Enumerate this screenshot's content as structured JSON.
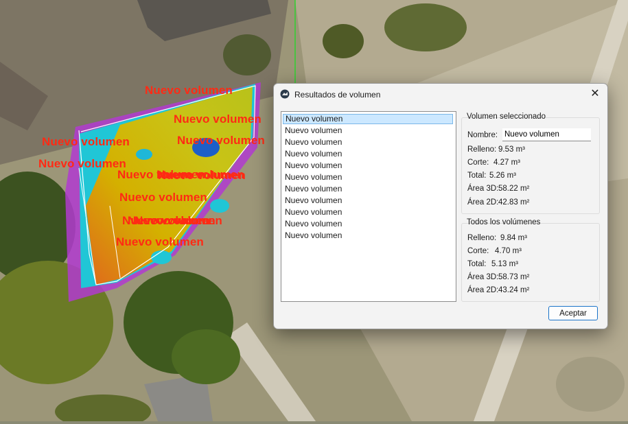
{
  "map_labels": [
    "Nuevo volumen",
    "Nuevo volumen",
    "Nuevo volumen",
    "Nuevo volumen",
    "Nuevo volumen",
    "Nuevo volumen",
    "Nuevo volumen",
    "Nuevo volumen",
    "Nuevo volumen",
    "Nuevo volumen",
    "Nuevo volumen",
    "Nuevo volumen",
    "Nuevo volumen"
  ],
  "dialog": {
    "title": "Resultados de volumen",
    "close_glyph": "✕",
    "list": [
      "Nuevo volumen",
      "Nuevo volumen",
      "Nuevo volumen",
      "Nuevo volumen",
      "Nuevo volumen",
      "Nuevo volumen",
      "Nuevo volumen",
      "Nuevo volumen",
      "Nuevo volumen",
      "Nuevo volumen",
      "Nuevo volumen"
    ],
    "selected": {
      "title": "Volumen seleccionado",
      "name_label": "Nombre:",
      "name_value": "Nuevo volumen",
      "rows": [
        {
          "label": "Relleno:",
          "value": "9.53 m³"
        },
        {
          "label": "Corte:",
          "value": "4.27 m³"
        },
        {
          "label": "Total:",
          "value": "5.26 m³"
        },
        {
          "label": "Área 3D:",
          "value": "58.22 m²"
        },
        {
          "label": "Área 2D:",
          "value": "42.83 m²"
        }
      ]
    },
    "all": {
      "title": "Todos los volúmenes",
      "rows": [
        {
          "label": "Relleno:",
          "value": "9.84 m³"
        },
        {
          "label": "Corte:",
          "value": "4.70 m³"
        },
        {
          "label": "Total:",
          "value": "5.13 m³"
        },
        {
          "label": "Área 3D:",
          "value": "58.73 m²"
        },
        {
          "label": "Área 2D:",
          "value": "43.24 m²"
        }
      ]
    },
    "accept_label": "Aceptar"
  },
  "colors": {
    "label_red": "#ff2a14",
    "accent": "#1a73c9",
    "selection": "#cce8ff"
  }
}
